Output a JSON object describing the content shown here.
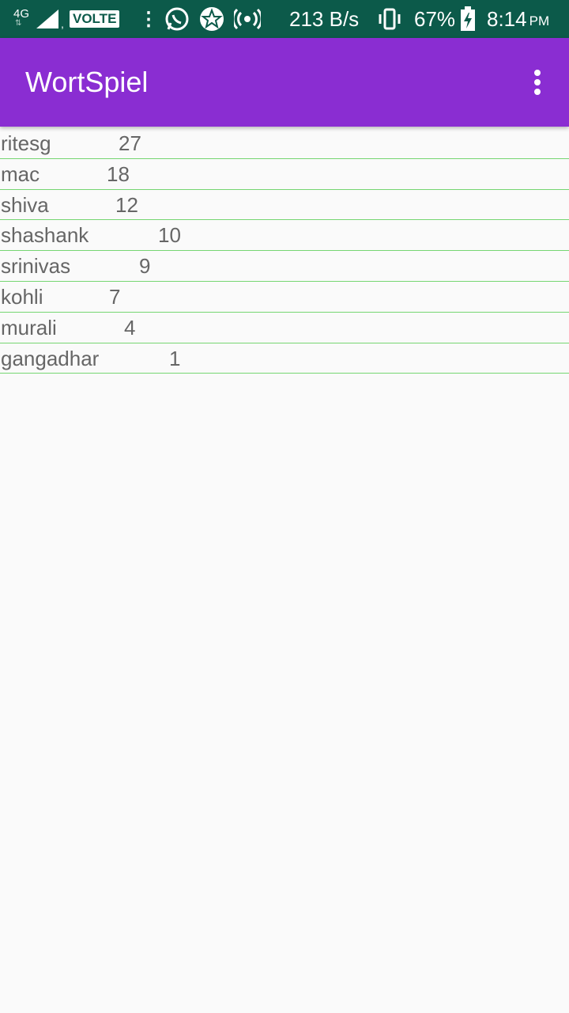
{
  "status_bar": {
    "network": "4G",
    "volte": "VOLTE",
    "data_speed": "213 B/s",
    "battery_percent": "67%",
    "time": "8:14",
    "ampm": "PM",
    "icons": [
      "signal-icon",
      "whatsapp-icon",
      "app-notification-icon",
      "hotspot-icon",
      "vibrate-icon",
      "battery-charging-icon"
    ]
  },
  "app_bar": {
    "title": "WortSpiel",
    "color": "#8a2dd2"
  },
  "scores": [
    {
      "name": "ritesg",
      "score": "27"
    },
    {
      "name": "mac",
      "score": "18"
    },
    {
      "name": "shiva",
      "score": "12"
    },
    {
      "name": "shashank",
      "score": "10"
    },
    {
      "name": "srinivas",
      "score": "9"
    },
    {
      "name": "kohli",
      "score": "7"
    },
    {
      "name": "murali",
      "score": "4"
    },
    {
      "name": "gangadhar",
      "score": "1"
    }
  ],
  "colors": {
    "status_bar": "#0c5a4a",
    "divider": "#76d672",
    "text": "#666666"
  }
}
